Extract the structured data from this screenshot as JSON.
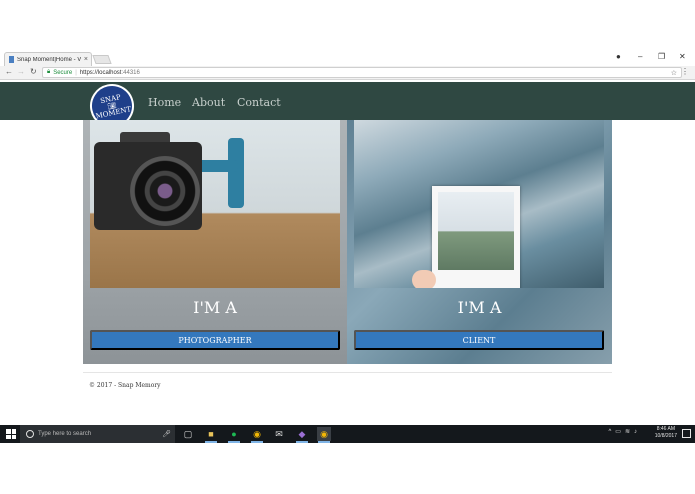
{
  "browser": {
    "tab_title": "Snap Moment|Home - V",
    "tab_close": "×",
    "back_icon": "arrow-left-icon",
    "forward_icon": "arrow-right-icon",
    "reload_icon": "reload-icon",
    "secure_label": "Secure",
    "url_scheme": "https://",
    "url_host": "localhost",
    "url_port": ":44316",
    "window_controls": {
      "minimize": "–",
      "maximize": "❐",
      "close": "✕"
    }
  },
  "site": {
    "logo_line1": "SNAP",
    "logo_line2": "MOMENT",
    "nav": [
      "Home",
      "About",
      "Contact"
    ],
    "cards": [
      {
        "title": "I'M A",
        "button": "PHOTOGRAPHER"
      },
      {
        "title": "I'M A",
        "button": "CLIENT"
      }
    ],
    "footer": "© 2017 - Snap Memory"
  },
  "taskbar": {
    "search_placeholder": "Type here to search",
    "time": "8:46 AM",
    "date": "10/8/2017"
  },
  "colors": {
    "navbar": "#2f4842",
    "button": "#3478bd",
    "logo": "#1f3f8a",
    "taskbar": "#14181c"
  }
}
